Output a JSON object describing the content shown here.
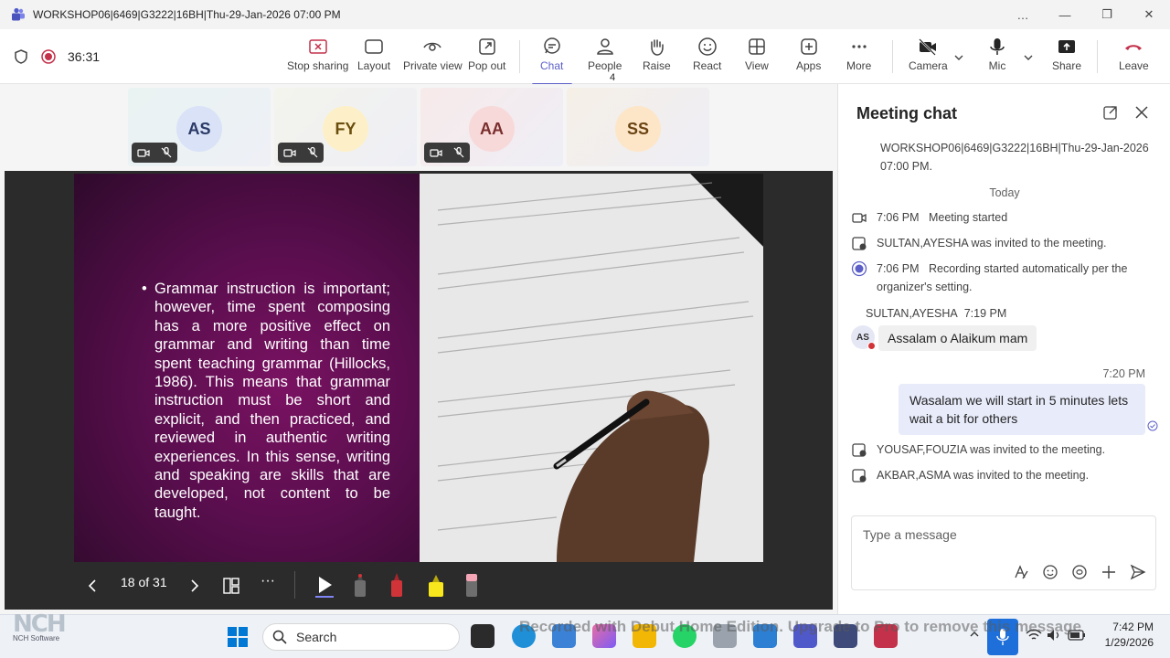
{
  "window": {
    "title": "WORKSHOP06|6469|G3222|16BH|Thu-29-Jan-2026 07:00 PM",
    "controls": [
      "…",
      "—",
      "❐",
      "✕"
    ]
  },
  "toolbar": {
    "timer": "36:31",
    "buttons": {
      "stop_sharing": "Stop sharing",
      "layout": "Layout",
      "private_view": "Private view",
      "pop_out": "Pop out",
      "chat": "Chat",
      "people": "People",
      "people_count": "4",
      "raise": "Raise",
      "react": "React",
      "view": "View",
      "apps": "Apps",
      "more": "More",
      "camera": "Camera",
      "mic": "Mic",
      "share": "Share",
      "leave": "Leave"
    },
    "colors": {
      "accent": "#5b5fc7",
      "leave": "#c4314b",
      "stop": "#c4314b"
    }
  },
  "participants": [
    {
      "initials": "AS",
      "bg": "#d9e2f7",
      "fg": "#2b3a67",
      "muted": true
    },
    {
      "initials": "FY",
      "bg": "#fdf0c8",
      "fg": "#6a4e0e",
      "muted": true
    },
    {
      "initials": "AA",
      "bg": "#f8d9d9",
      "fg": "#7a2e2e",
      "muted": true
    },
    {
      "initials": "SS",
      "bg": "#fde6c8",
      "fg": "#6a4413",
      "muted": false
    }
  ],
  "slide": {
    "text": "Grammar instruction is important; however, time spent composing has a more positive effect on grammar and writing than time spent teaching grammar (Hillocks, 1986). This means that grammar instruction must be short and explicit, and then practiced, and reviewed in authentic writing experiences. In this sense, writing and speaking are skills that are developed, not content to be taught.",
    "page_indicator": "18 of 31",
    "more": "···"
  },
  "chat": {
    "title": "Meeting chat",
    "header_meta": "WORKSHOP06|6469|G3222|16BH|Thu-29-Jan-2026 07:00 PM.",
    "today": "Today",
    "events": {
      "meeting_started_time": "7:06 PM",
      "meeting_started": "Meeting started",
      "invite_1": "SULTAN,AYESHA was invited to the meeting.",
      "recording_time": "7:06 PM",
      "recording": "Recording started automatically per the organizer's setting.",
      "invite_2": "YOUSAF,FOUZIA was invited to the meeting.",
      "invite_3": "AKBAR,ASMA was invited to the meeting."
    },
    "incoming": {
      "sender": "SULTAN,AYESHA",
      "time": "7:19 PM",
      "initials": "AS",
      "text": "Assalam o Alaikum mam"
    },
    "outgoing": {
      "time": "7:20 PM",
      "text": "Wasalam we will start in 5 minutes lets wait a bit for others"
    },
    "compose_placeholder": "Type a message"
  },
  "taskbar": {
    "search": "Search",
    "time": "7:42 PM",
    "date": "1/29/2026",
    "watermark": "Recorded with Debut Home Edition. Upgrade to Pro to remove this message",
    "nch_logo": "NCH",
    "nch_sub": "NCH Software"
  }
}
